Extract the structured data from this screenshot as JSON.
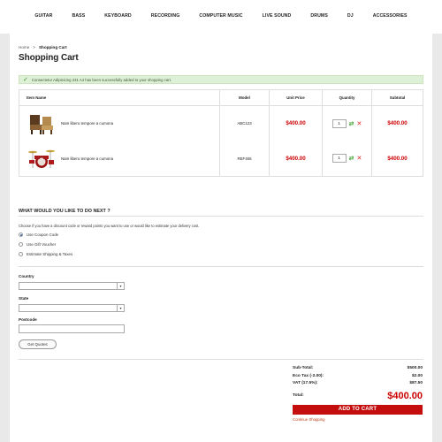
{
  "nav": {
    "items": [
      "GUITAR",
      "BASS",
      "KEYBOARD",
      "RECORDING",
      "COMPUTER MUSIC",
      "LIVE SOUND",
      "DRUMS",
      "DJ",
      "ACCESSORIES"
    ]
  },
  "breadcrumb": {
    "home": "Home",
    "separator": ">",
    "current": "Shopping Cart"
  },
  "page_title": "Shopping Cart",
  "alert": {
    "message": "Consectetur Adipisicing 231 A4 has been successfully added to your shopping cart."
  },
  "cart": {
    "headers": {
      "item": "Item Name",
      "model": "Model",
      "unit_price": "Unit Price",
      "quantity": "Quantity",
      "subtotal": "Subtotal"
    },
    "rows": [
      {
        "name": "Nam libero tempore a cumona",
        "model": "ABC123",
        "unit_price": "$400.00",
        "quantity": "1",
        "subtotal": "$400.00",
        "thumb": "chairs"
      },
      {
        "name": "Nam libero tempore a cumona",
        "model": "REF455",
        "unit_price": "$400.00",
        "quantity": "1",
        "subtotal": "$400.00",
        "thumb": "drum-kit"
      }
    ]
  },
  "next": {
    "title": "WHAT WOULD YOU LIKE TO DO NEXT ?",
    "description": "Choose if you have a discount code or reward points you want to use or would like to estimate your delivery cost.",
    "options": [
      "Use Coupon Code",
      "Use Gift Voucher",
      "Estimate Shipping & Taxes"
    ],
    "selected_index": 0
  },
  "estimate": {
    "country_label": "Country",
    "country_value": "",
    "state_label": "State",
    "state_value": "",
    "postcode_label": "Postcode",
    "postcode_value": "",
    "quote_button": "Get Quotes"
  },
  "totals": {
    "sub_total_label": "Sub-Total:",
    "sub_total": "$500.00",
    "eco_tax_label": "Eco Tax (-2.00):",
    "eco_tax": "$2.00",
    "vat_label": "VAT (17.5%):",
    "vat": "$87.50",
    "total_label": "Total:",
    "total": "$400.00",
    "add_to_cart": "ADD TO CART",
    "continue": "Continue Shopping"
  },
  "colors": {
    "accent": "#c40d0d",
    "price": "#cc0000",
    "alert_bg": "#dff0d8"
  }
}
